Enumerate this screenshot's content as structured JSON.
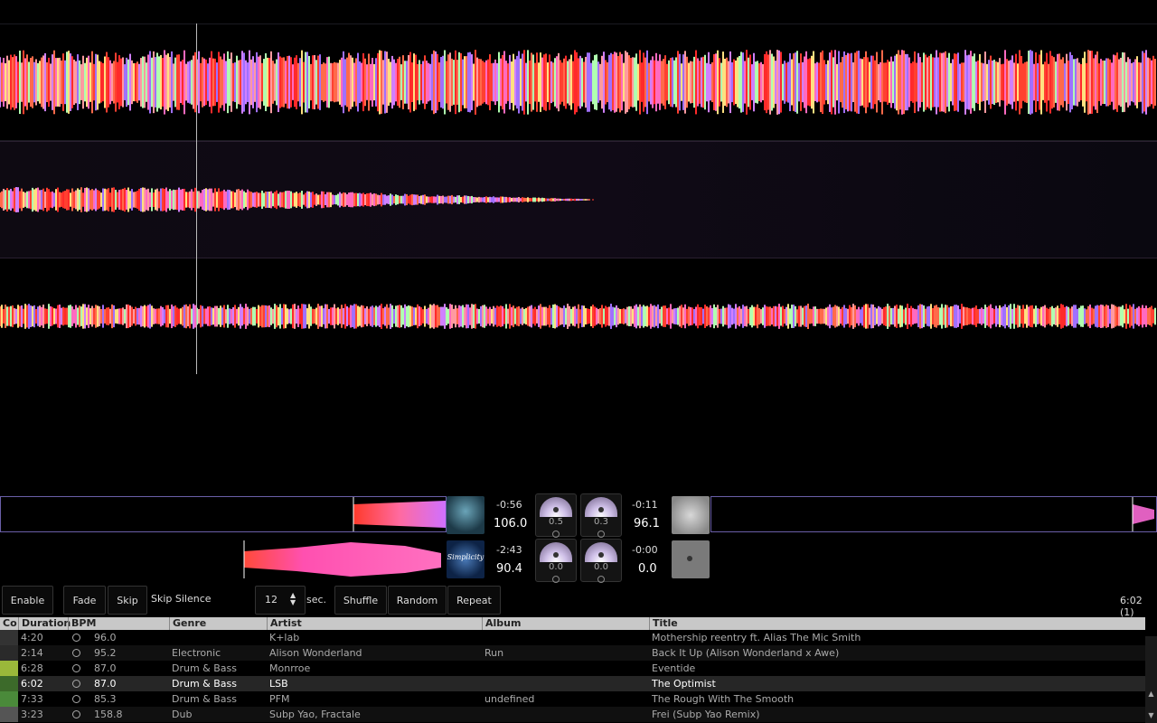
{
  "decks": {
    "deck1": {
      "time": "-0:56",
      "bpm": "106.0"
    },
    "deck2": {
      "time": "-2:43",
      "bpm": "90.4"
    },
    "deck3": {
      "time": "-0:11",
      "bpm": "96.1"
    },
    "deck4": {
      "time": "-0:00",
      "bpm": "0.0"
    },
    "deck2_cover_text": "Simplicity"
  },
  "knobs": [
    "0.5",
    "0.3",
    "0.0",
    "0.0"
  ],
  "automix": {
    "enable": "Enable",
    "fade": "Fade",
    "skip": "Skip",
    "skip_silence": "Skip Silence",
    "transition_value": "12",
    "transition_unit": "sec.",
    "shuffle": "Shuffle",
    "random": "Random",
    "repeat": "Repeat",
    "total": "6:02 (1)"
  },
  "table": {
    "columns": [
      "Co",
      "Duration",
      "BPM",
      "Genre",
      "Artist",
      "Album",
      "Title"
    ],
    "rows": [
      {
        "duration": "4:20",
        "bpm": "96.0",
        "genre": "",
        "artist": "K+lab",
        "album": "",
        "title": "Mothership reentry ft. Alias  The Mic Smith",
        "thumb": "#333333"
      },
      {
        "duration": "2:14",
        "bpm": "95.2",
        "genre": "Electronic",
        "artist": "Alison Wonderland",
        "album": "Run",
        "title": "Back It Up (Alison Wonderland x Awe)",
        "thumb": "#2a2a2a"
      },
      {
        "duration": "6:28",
        "bpm": "87.0",
        "genre": "Drum & Bass",
        "artist": "Monrroe",
        "album": "",
        "title": "Eventide",
        "thumb": "#9ab83a"
      },
      {
        "duration": "6:02",
        "bpm": "87.0",
        "genre": "Drum & Bass",
        "artist": "LSB",
        "album": "",
        "title": "The Optimist",
        "thumb": "#3c6a2a"
      },
      {
        "duration": "7:33",
        "bpm": "85.3",
        "genre": "Drum & Bass",
        "artist": "PFM",
        "album": "undefined",
        "title": "The Rough With The Smooth",
        "thumb": "#4a8a3a"
      },
      {
        "duration": "3:23",
        "bpm": "158.8",
        "genre": "Dub",
        "artist": "Subp Yao, Fractale",
        "album": "",
        "title": "Frei (Subp Yao Remix)",
        "thumb": "#555555"
      }
    ],
    "current_row": 3
  }
}
